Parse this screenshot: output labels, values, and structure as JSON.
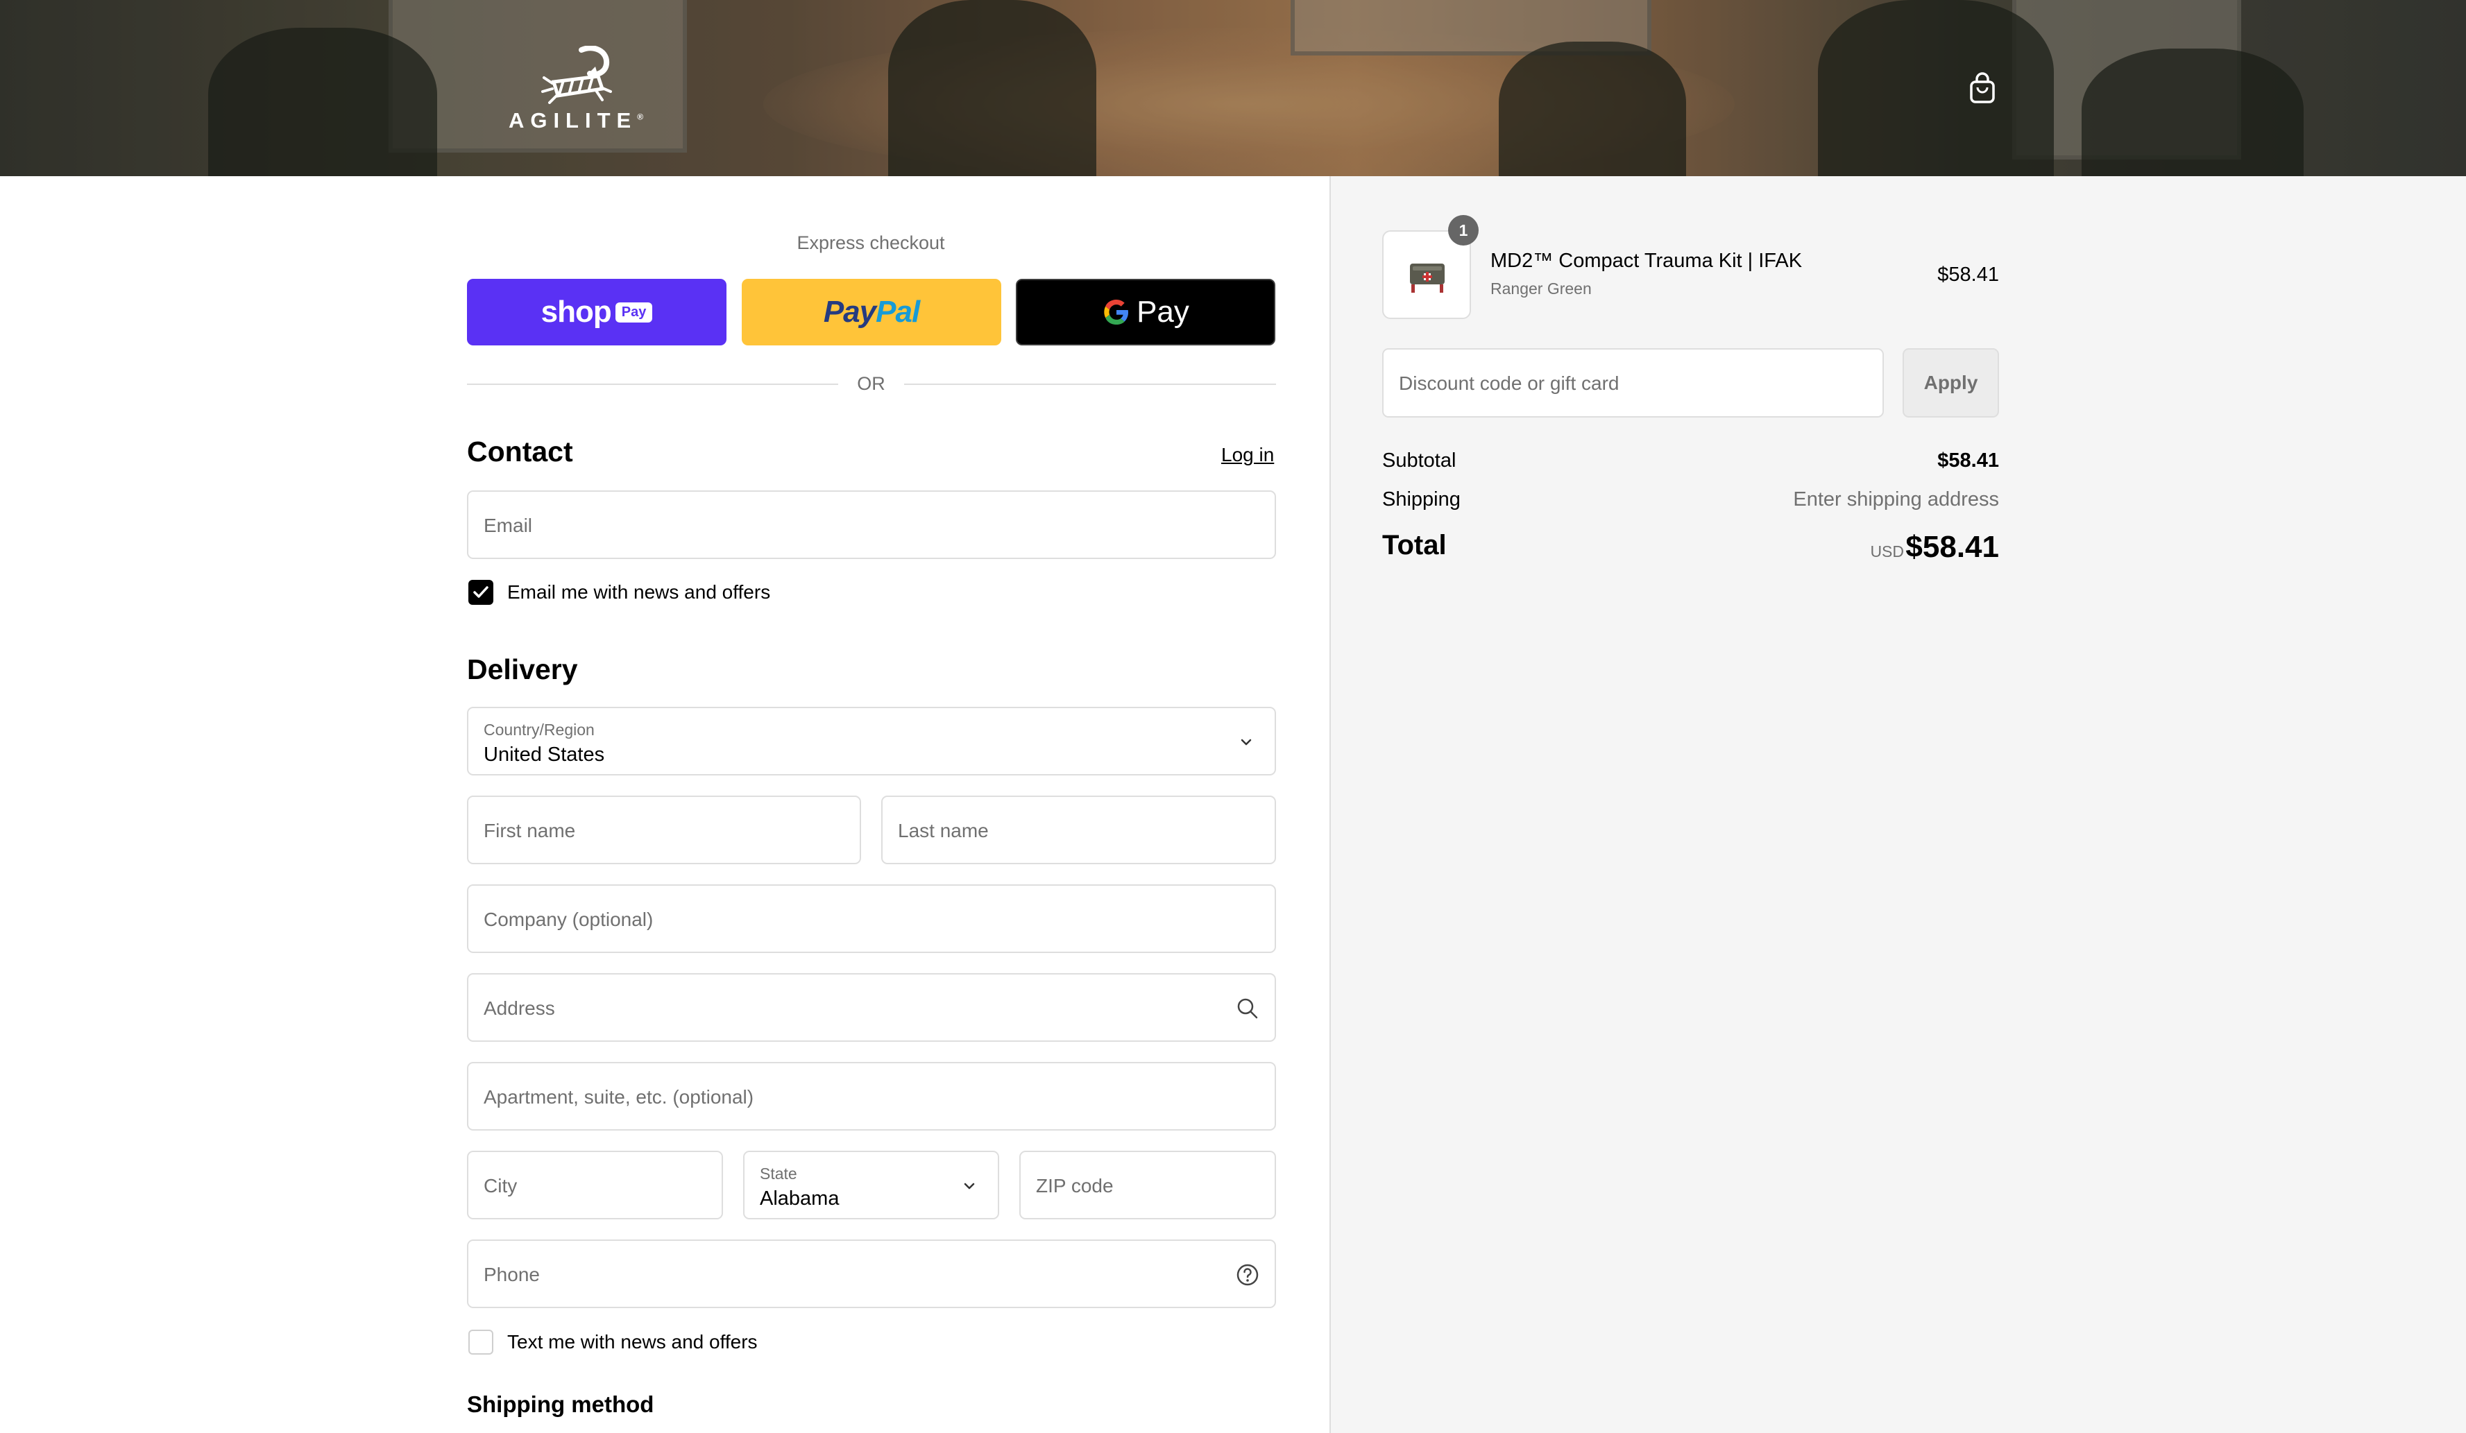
{
  "header": {
    "brand": "AGILITE",
    "trademark": "®"
  },
  "express_checkout": {
    "title": "Express checkout",
    "shop_pay": {
      "word": "shop",
      "pill": "Pay"
    },
    "paypal": {
      "part1": "Pay",
      "part2": "Pal"
    },
    "google_pay": {
      "word": "Pay"
    },
    "or_label": "OR"
  },
  "contact": {
    "title": "Contact",
    "login_label": "Log in",
    "email_placeholder": "Email",
    "news_checkbox_label": "Email me with news and offers",
    "news_checked": true
  },
  "delivery": {
    "title": "Delivery",
    "country_label": "Country/Region",
    "country_value": "United States",
    "first_name_placeholder": "First name",
    "last_name_placeholder": "Last name",
    "company_placeholder": "Company (optional)",
    "address_placeholder": "Address",
    "apartment_placeholder": "Apartment, suite, etc. (optional)",
    "city_placeholder": "City",
    "state_label": "State",
    "state_value": "Alabama",
    "zip_placeholder": "ZIP code",
    "phone_placeholder": "Phone",
    "text_checkbox_label": "Text me with news and offers",
    "text_checked": false
  },
  "shipping_method": {
    "title": "Shipping method"
  },
  "summary": {
    "item": {
      "quantity": "1",
      "name": "MD2™ Compact Trauma Kit | IFAK",
      "variant": "Ranger Green",
      "price": "$58.41"
    },
    "discount_placeholder": "Discount code or gift card",
    "apply_label": "Apply",
    "subtotal_label": "Subtotal",
    "subtotal_value": "$58.41",
    "shipping_label": "Shipping",
    "shipping_value": "Enter shipping address",
    "total_label": "Total",
    "currency": "USD",
    "total_value": "$58.41"
  },
  "colors": {
    "shop_pay": "#5a31f4",
    "paypal": "#ffc439",
    "paypal_dark": "#253b80",
    "paypal_light": "#179bd7",
    "google_pay": "#000000",
    "summary_bg": "#f5f5f5",
    "muted_text": "#707070",
    "border": "#dedede"
  },
  "icons": {
    "logo": "scorpion-logo-icon",
    "cart": "shopping-bag-icon",
    "country_chevron": "chevron-down-icon",
    "address_search": "search-icon",
    "state_chevron": "chevron-down-icon",
    "phone_help": "help-circle-icon",
    "checkbox": "checkmark-icon",
    "product": "trauma-kit-thumbnail-icon"
  }
}
